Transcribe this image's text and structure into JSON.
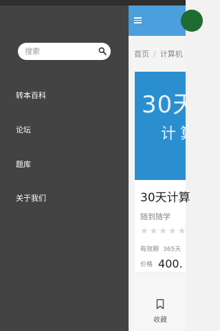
{
  "drawer": {
    "search_placeholder": "搜索",
    "items": [
      {
        "label": "转本百科"
      },
      {
        "label": "论坛"
      },
      {
        "label": "题库"
      },
      {
        "label": "关于我们"
      }
    ]
  },
  "page": {
    "breadcrumb": [
      "首页",
      "/",
      "计算机"
    ],
    "banner_text": [
      "30天",
      "计算"
    ],
    "course_title": "30天计算",
    "author": "随到随学",
    "rating_stars": 5,
    "validity_label": "有效期",
    "validity_value": "365天",
    "price_label": "价格",
    "price_value": "400.",
    "favorite_label": "收藏"
  },
  "colors": {
    "drawer_bg": "#434343",
    "appbar": "#4a9fdc",
    "banner": "#2b8fcf",
    "avatar": "#1f6b30"
  }
}
